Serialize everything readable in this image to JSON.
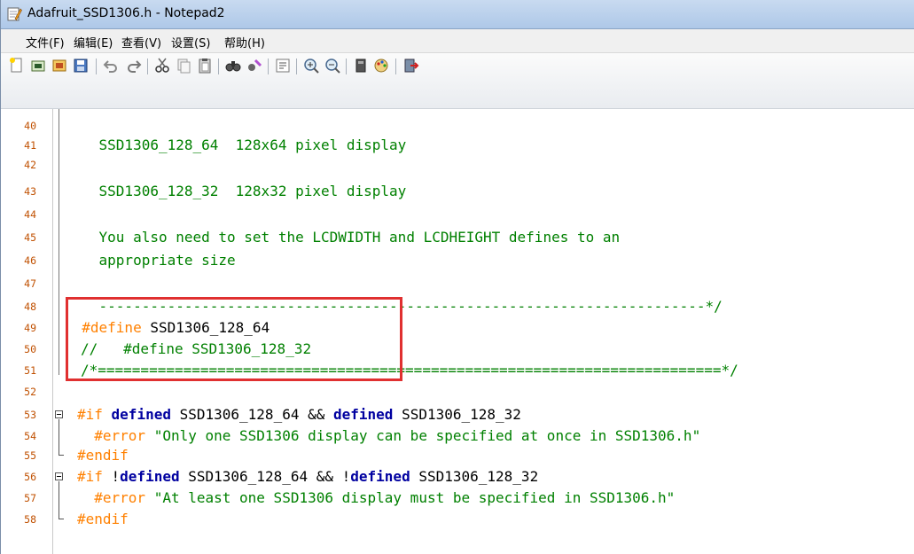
{
  "window": {
    "title": "Adafruit_SSD1306.h - Notepad2"
  },
  "menu": {
    "items": [
      {
        "label": "文件(F)"
      },
      {
        "label": "编辑(E)"
      },
      {
        "label": "查看(V)"
      },
      {
        "label": "设置(S)"
      },
      {
        "label": "帮助(H)"
      }
    ]
  },
  "toolbar": {
    "buttons": [
      "new-file-icon",
      "open-file-icon",
      "browse-icon",
      "save-icon",
      "undo-icon",
      "redo-icon",
      "cut-icon",
      "copy-icon",
      "paste-icon",
      "find-icon",
      "replace-icon",
      "word-wrap-icon",
      "zoom-in-icon",
      "zoom-out-icon",
      "scheme-icon",
      "customize-scheme-icon",
      "exit-icon"
    ]
  },
  "editor": {
    "lines": [
      {
        "num": "40",
        "text": ""
      },
      {
        "num": "41",
        "text": "    SSD1306_128_64  128x64 pixel display"
      },
      {
        "num": "42",
        "text": ""
      },
      {
        "num": "43",
        "text": "    SSD1306_128_32  128x32 pixel display"
      },
      {
        "num": "44",
        "text": ""
      },
      {
        "num": "45",
        "text": "    You also need to set the LCDWIDTH and LCDHEIGHT defines to an"
      },
      {
        "num": "46",
        "text": "    appropriate size"
      },
      {
        "num": "47",
        "text": ""
      },
      {
        "num": "48",
        "text": "    -----------------------------------------------------------------------*/"
      },
      {
        "num": "49",
        "pre": "  #define",
        "rest": " SSD1306_128_64"
      },
      {
        "num": "50",
        "text": "//   #define SSD1306_128_32"
      },
      {
        "num": "51",
        "text": "/*=========================================================================*/"
      },
      {
        "num": "52",
        "text": ""
      },
      {
        "num": "53",
        "pre": "#if",
        "kw": " defined",
        "rest": " SSD1306_128_64 && ",
        "kw2": "defined",
        "rest2": " SSD1306_128_32"
      },
      {
        "num": "54",
        "pre": "  #error",
        "str": " \"Only one SSD1306 display can be specified at once in SSD1306.h\""
      },
      {
        "num": "55",
        "pre": "#endif"
      },
      {
        "num": "56",
        "pre": "#if",
        "rest0": " !",
        "kw": "defined",
        "rest": " SSD1306_128_64 && !",
        "kw2": "defined",
        "rest2": " SSD1306_128_32"
      },
      {
        "num": "57",
        "pre": "  #error",
        "str": " \"At least one SSD1306 display must be specified in SSD1306.h\""
      },
      {
        "num": "58",
        "pre": "#endif"
      }
    ]
  }
}
